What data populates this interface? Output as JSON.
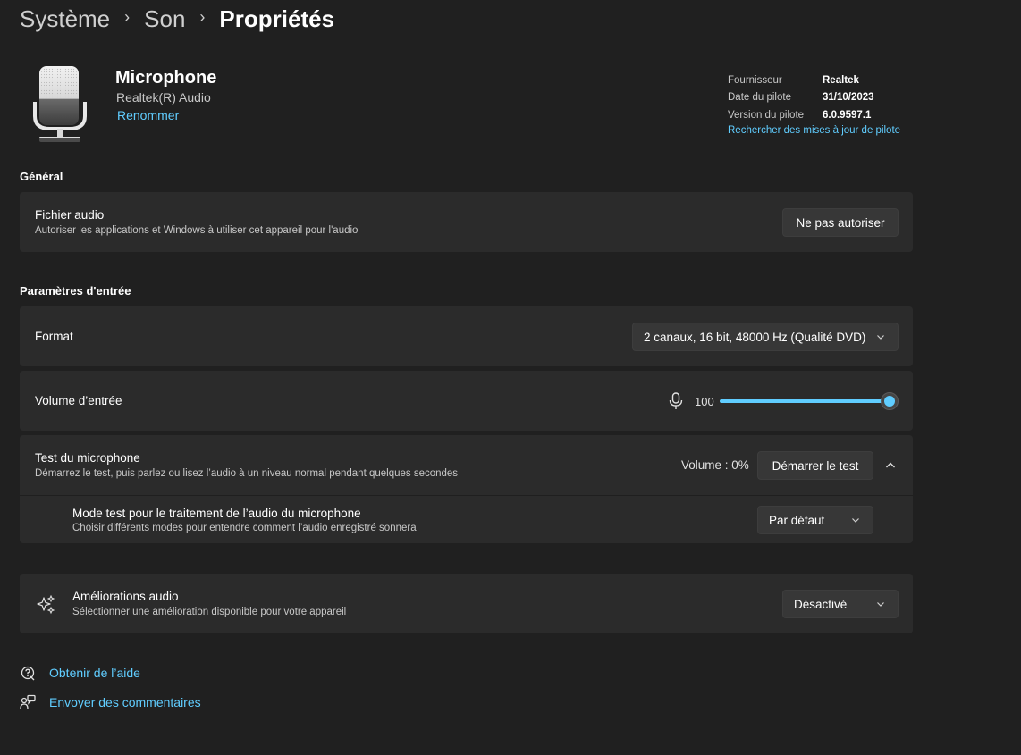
{
  "breadcrumb": {
    "items": [
      "Système",
      "Son"
    ],
    "current": "Propriétés",
    "separator": "›"
  },
  "device": {
    "name": "Microphone",
    "subtitle": "Realtek(R) Audio",
    "rename_label": "Renommer",
    "icon": "microphone-device-image"
  },
  "driver": {
    "rows": [
      {
        "key": "Fournisseur",
        "value": "Realtek"
      },
      {
        "key": "Date du pilote",
        "value": "31/10/2023"
      },
      {
        "key": "Version du pilote",
        "value": "6.0.9597.1"
      }
    ],
    "update_link": "Rechercher des mises à jour de pilote"
  },
  "general": {
    "title": "Général",
    "audio_file": {
      "title": "Fichier audio",
      "desc": "Autoriser les applications et Windows à utiliser cet appareil pour l'audio",
      "button": "Ne pas autoriser"
    }
  },
  "input_settings": {
    "title": "Paramètres d'entrée",
    "format": {
      "title": "Format",
      "value": "2 canaux, 16 bit, 48000 Hz (Qualité DVD)"
    },
    "volume": {
      "title": "Volume d’entrée",
      "value": "100",
      "level": 1.0,
      "icon": "microphone-icon"
    },
    "mic_test": {
      "title": "Test du microphone",
      "desc": "Démarrez le test, puis parlez ou lisez l’audio à un niveau normal pendant quelques secondes",
      "volume_label": "Volume : 0%",
      "button": "Démarrer le test",
      "expand_icon": "chevron-up-icon"
    },
    "test_mode": {
      "title": "Mode test pour le traitement de l’audio du microphone",
      "desc": "Choisir différents modes pour entendre comment l’audio enregistré sonnera",
      "value": "Par défaut"
    }
  },
  "enhancements": {
    "title": "Améliorations audio",
    "desc": "Sélectionner une amélioration disponible pour votre appareil",
    "value": "Désactivé",
    "icon": "sparkle-icon"
  },
  "footer": {
    "help": "Obtenir de l’aide",
    "feedback": "Envoyer des commentaires"
  },
  "colors": {
    "accent": "#60cdff",
    "background": "#202020",
    "card": "#2b2b2b",
    "control": "#373737"
  }
}
